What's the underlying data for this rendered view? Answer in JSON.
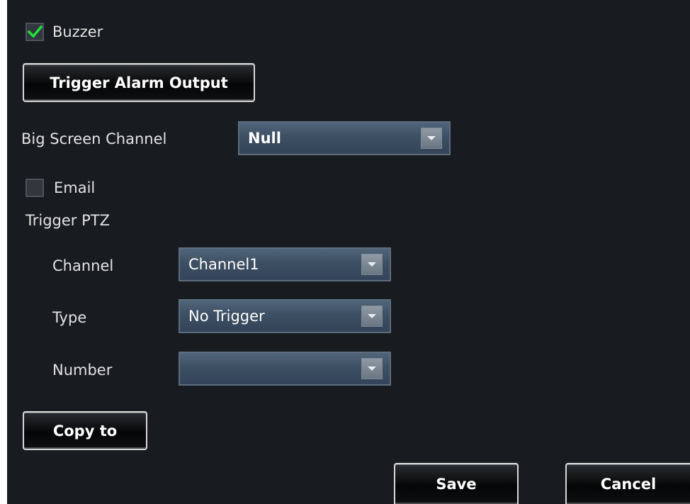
{
  "buzzer": {
    "label": "Buzzer",
    "checked": true
  },
  "trigger_alarm_output": {
    "label": "Trigger Alarm Output"
  },
  "big_screen_channel": {
    "label": "Big Screen Channel",
    "value": "Null"
  },
  "email": {
    "label": "Email",
    "checked": false
  },
  "trigger_ptz": {
    "heading": "Trigger PTZ",
    "channel": {
      "label": "Channel",
      "value": "Channel1"
    },
    "type": {
      "label": "Type",
      "value": "No Trigger"
    },
    "number": {
      "label": "Number",
      "value": ""
    }
  },
  "copy_to": {
    "label": "Copy to"
  },
  "footer": {
    "save_label": "Save",
    "cancel_label": "Cancel"
  },
  "colors": {
    "background": "#181b1f",
    "check_mark": "#22e03c",
    "select_fill": "#3d4f62"
  },
  "icons": {
    "check": "check-icon",
    "dropdown": "chevron-down-icon"
  }
}
